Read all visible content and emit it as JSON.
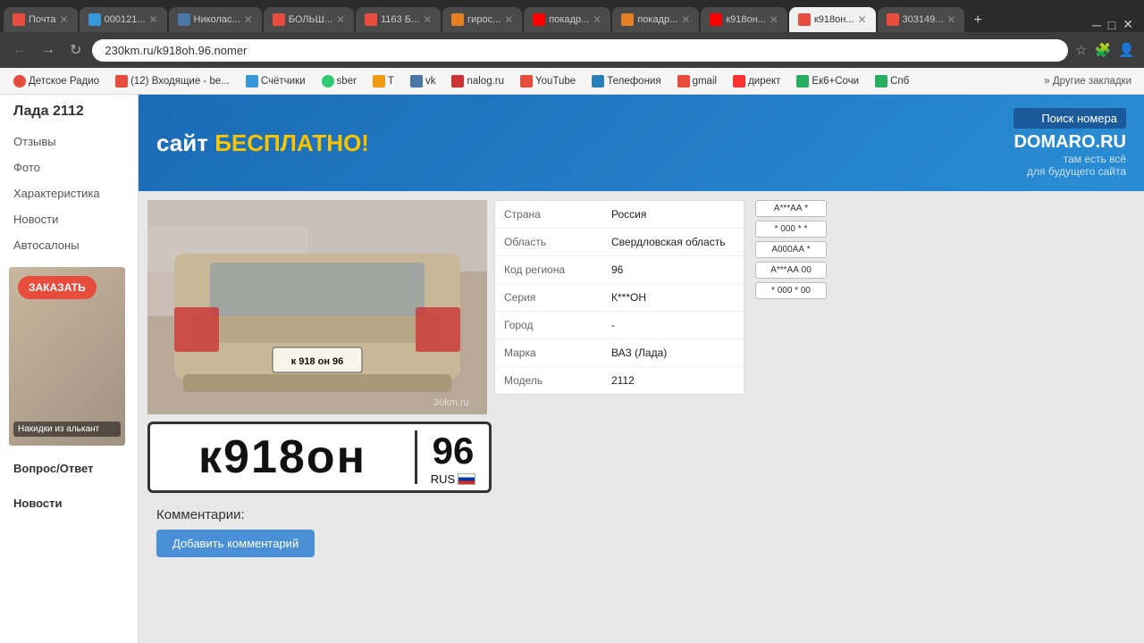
{
  "browser": {
    "url": "230km.ru/k918oh.96.nomer",
    "tabs": [
      {
        "id": "tab1",
        "label": "Почта",
        "fav_color": "#e74c3c",
        "active": false
      },
      {
        "id": "tab2",
        "label": "000121...",
        "fav_color": "#3498db",
        "active": false
      },
      {
        "id": "tab3",
        "label": "Николас...",
        "fav_color": "#4a76a8",
        "active": false
      },
      {
        "id": "tab4",
        "label": "БОЛЬШ...",
        "fav_color": "#e74c3c",
        "active": false
      },
      {
        "id": "tab5",
        "label": "1163 Б...",
        "fav_color": "#e74c3c",
        "active": false
      },
      {
        "id": "tab6",
        "label": "гирос...",
        "fav_color": "#e67e22",
        "active": false
      },
      {
        "id": "tab7",
        "label": "покадр...",
        "fav_color": "#f33",
        "active": false
      },
      {
        "id": "tab8",
        "label": "покадр...",
        "fav_color": "#e67e22",
        "active": false
      },
      {
        "id": "tab9",
        "label": "к918он...",
        "fav_color": "#f33",
        "active": false
      },
      {
        "id": "tab10",
        "label": "к918он...",
        "fav_color": "#e74c3c",
        "active": true
      },
      {
        "id": "tab11",
        "label": "303149...",
        "fav_color": "#e74c3c",
        "active": false
      }
    ],
    "bookmarks": [
      {
        "label": "Детское Радио",
        "fav_color": "#e74c3c"
      },
      {
        "label": "(12) Входящие - be...",
        "fav_color": "#e74c3c"
      },
      {
        "label": "Счётчики",
        "fav_color": "#3498db"
      },
      {
        "label": "sber",
        "fav_color": "#2ecc71"
      },
      {
        "label": "Т",
        "fav_color": "#f39c12"
      },
      {
        "label": "vk",
        "fav_color": "#4a76a8"
      },
      {
        "label": "nalog.ru",
        "fav_color": "#cc3333"
      },
      {
        "label": "YouTube",
        "fav_color": "#e74c3c"
      },
      {
        "label": "Телефония",
        "fav_color": "#2980b9"
      },
      {
        "label": "gmail",
        "fav_color": "#e74c3c"
      },
      {
        "label": "директ",
        "fav_color": "#f33"
      },
      {
        "label": "Ек6+Сочи",
        "fav_color": "#27ae60"
      },
      {
        "label": "Спб",
        "fav_color": "#27ae60"
      },
      {
        "label": "Другие закладки",
        "fav_color": "#888"
      }
    ]
  },
  "ad_banner": {
    "prefix": "сайт ",
    "main": "БЕСПЛАТНО!",
    "search_label": "Поиск номера",
    "domain": "DOMARO.RU",
    "desc_line1": "там есть всё",
    "desc_line2": "для будущего сайта"
  },
  "sidebar": {
    "title": "Лада 2112",
    "menu_items": [
      "Отзывы",
      "Фото",
      "Характеристика",
      "Новости",
      "Автосалоны"
    ],
    "ad_button": "ЗАКАЗАТЬ",
    "ad_caption": "Накидки из алькант",
    "bottom_items": [
      "Вопрос/Ответ",
      "Новости"
    ]
  },
  "car_info": {
    "country_label": "Страна",
    "country_value": "Россия",
    "region_label": "Область",
    "region_value": "Свердловская область",
    "code_label": "Код региона",
    "code_value": "96",
    "series_label": "Серия",
    "series_value": "К***ОН",
    "city_label": "Город",
    "city_value": "-",
    "brand_label": "Марка",
    "brand_value": "ВАЗ (Лада)",
    "model_label": "Модель",
    "model_value": "2112"
  },
  "license_plate": {
    "main": "к918он",
    "region": "96",
    "country": "RUS"
  },
  "small_plates": [
    "А***АА *",
    "* 000 * *",
    "А000АА *",
    "А***АА 00",
    "* 000 * 00"
  ],
  "comments": {
    "title": "Комментарии:",
    "add_button": "Добавить комментарий"
  }
}
